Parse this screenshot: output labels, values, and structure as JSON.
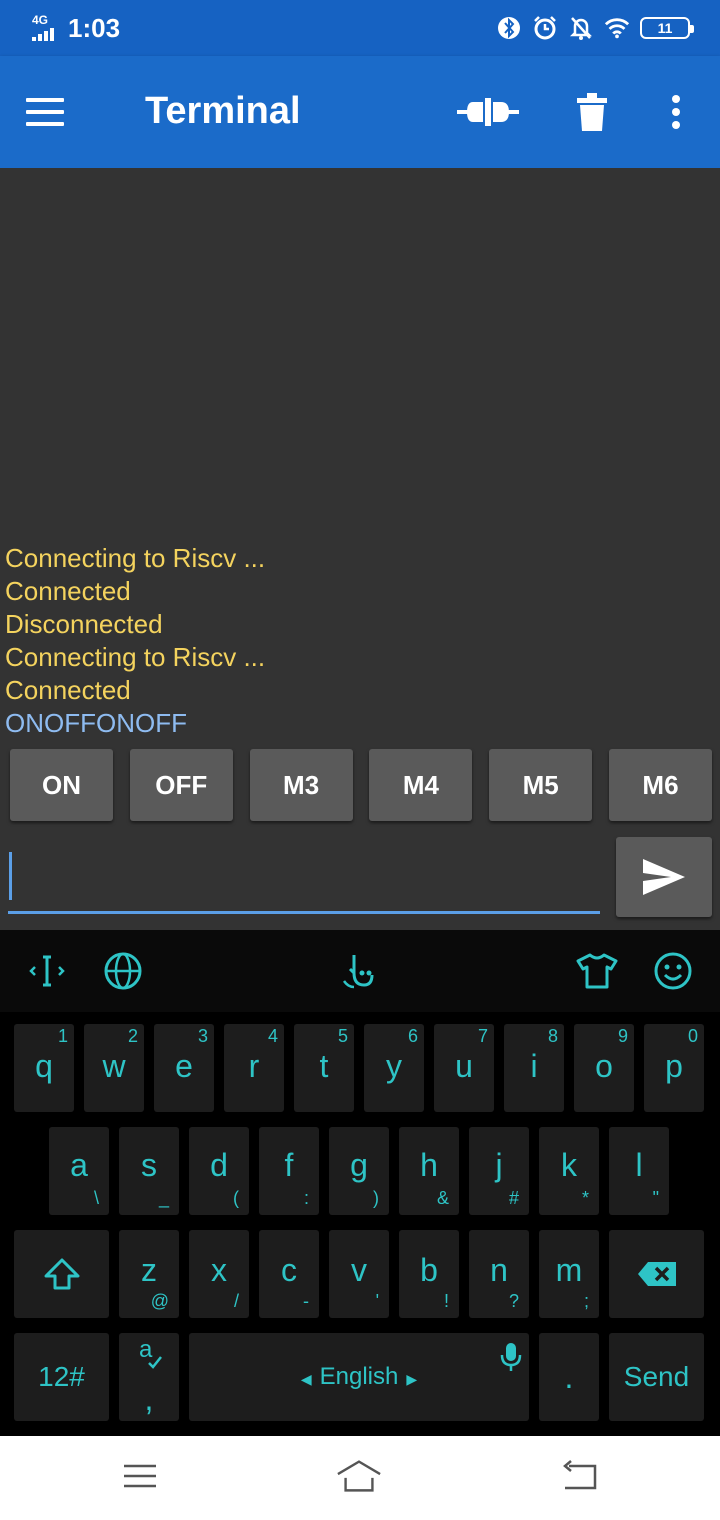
{
  "status_bar": {
    "network": "4G",
    "time": "1:03",
    "battery": "11"
  },
  "app_bar": {
    "title": "Terminal"
  },
  "terminal": {
    "lines": [
      {
        "text": "Connecting to Riscv ...",
        "kind": "status"
      },
      {
        "text": "Connected",
        "kind": "status"
      },
      {
        "text": "Disconnected",
        "kind": "status"
      },
      {
        "text": "Connecting to Riscv ...",
        "kind": "status"
      },
      {
        "text": "Connected",
        "kind": "status"
      },
      {
        "text": "ONOFFONOFF",
        "kind": "received"
      }
    ],
    "macros": [
      "ON",
      "OFF",
      "M3",
      "M4",
      "M5",
      "M6"
    ],
    "input_value": ""
  },
  "keyboard": {
    "row1": [
      {
        "key": "q",
        "num": "1"
      },
      {
        "key": "w",
        "num": "2"
      },
      {
        "key": "e",
        "num": "3"
      },
      {
        "key": "r",
        "num": "4"
      },
      {
        "key": "t",
        "num": "5"
      },
      {
        "key": "y",
        "num": "6"
      },
      {
        "key": "u",
        "num": "7"
      },
      {
        "key": "i",
        "num": "8"
      },
      {
        "key": "o",
        "num": "9"
      },
      {
        "key": "p",
        "num": "0"
      }
    ],
    "row2": [
      {
        "key": "a",
        "sym": "\\"
      },
      {
        "key": "s",
        "sym": "_"
      },
      {
        "key": "d",
        "sym": "("
      },
      {
        "key": "f",
        "sym": ":"
      },
      {
        "key": "g",
        "sym": ")"
      },
      {
        "key": "h",
        "sym": "&"
      },
      {
        "key": "j",
        "sym": "#"
      },
      {
        "key": "k",
        "sym": "*"
      },
      {
        "key": "l",
        "sym": "\""
      }
    ],
    "row3": [
      {
        "key": "z",
        "sym": "@"
      },
      {
        "key": "x",
        "sym": "/"
      },
      {
        "key": "c",
        "sym": "-"
      },
      {
        "key": "v",
        "sym": "'"
      },
      {
        "key": "b",
        "sym": "!"
      },
      {
        "key": "n",
        "sym": "?"
      },
      {
        "key": "m",
        "sym": ";"
      }
    ],
    "symbols_key": "12#",
    "comma_key": ",",
    "space_label": "English",
    "period_key": ".",
    "send_key": "Send"
  },
  "colors": {
    "primary": "#1b6bc9",
    "status_text": "#f4d35e",
    "received_text": "#8ebbf0",
    "keyboard_accent": "#2ec4c6"
  }
}
